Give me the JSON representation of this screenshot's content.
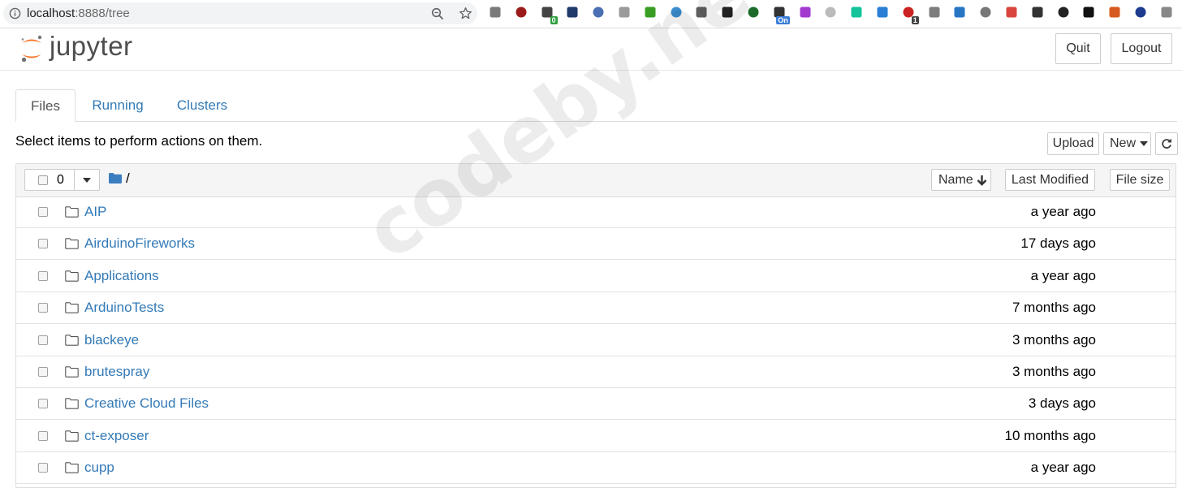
{
  "browser": {
    "url_host": "localhost",
    "url_rest": ":8888/tree",
    "extensions": [
      {
        "icon": "puzzle-icon",
        "color": "#7a7a7a",
        "badge": ""
      },
      {
        "icon": "ublock-icon",
        "color": "#9b1b1b",
        "badge": ""
      },
      {
        "icon": "scissors-icon",
        "color": "#444444",
        "badge": "0",
        "badge_color": "#2e9e3e"
      },
      {
        "icon": "y-icon",
        "color": "#1f3a6b",
        "badge": ""
      },
      {
        "icon": "globe-icon",
        "color": "#4a6fb3",
        "badge": ""
      },
      {
        "icon": "disc-icon",
        "color": "#9a9a9a",
        "badge": ""
      },
      {
        "icon": "location-pin-icon",
        "color": "#3a9d23",
        "badge": ""
      },
      {
        "icon": "screenshot-icon",
        "color": "#3b8ed0",
        "badge": ""
      },
      {
        "icon": "download-icon",
        "color": "#5f5f5f",
        "badge": ""
      },
      {
        "icon": "terminal-icon",
        "color": "#222222",
        "badge": ""
      },
      {
        "icon": "bw-icon",
        "color": "#1d6b2a",
        "badge": ""
      },
      {
        "icon": "window-icon",
        "color": "#333333",
        "badge": "On",
        "badge_color": "#3b7dd8"
      },
      {
        "icon": "purple-circle-icon",
        "color": "#a23ad0",
        "badge": ""
      },
      {
        "icon": "ink-icon",
        "color": "#bbbbbb",
        "badge": ""
      },
      {
        "icon": "grammarly-icon",
        "color": "#15c39a",
        "badge": ""
      },
      {
        "icon": "wave-icon",
        "color": "#2a7fd4",
        "badge": ""
      },
      {
        "icon": "red-square-icon",
        "color": "#cc2222",
        "badge": "1",
        "badge_color": "#444444"
      },
      {
        "icon": "drive-icon",
        "color": "#7d7d7d",
        "badge": ""
      },
      {
        "icon": "eye-icon",
        "color": "#2676c4",
        "badge": ""
      },
      {
        "icon": "tag-icon",
        "color": "#777777",
        "badge": ""
      },
      {
        "icon": "checker-icon",
        "color": "#d9453d",
        "badge": ""
      },
      {
        "icon": "graduation-cap-icon",
        "color": "#333333",
        "badge": ""
      },
      {
        "icon": "arrow-icon",
        "color": "#222222",
        "badge": ""
      },
      {
        "icon": "speaker-icon",
        "color": "#111111",
        "badge": ""
      },
      {
        "icon": "line-icon",
        "color": "#d65a1f",
        "badge": ""
      },
      {
        "icon": "n-icon",
        "color": "#1d3b8f",
        "badge": ""
      },
      {
        "icon": "camera-icon",
        "color": "#888888",
        "badge": ""
      }
    ]
  },
  "header": {
    "logo_text": "jupyter",
    "quit_label": "Quit",
    "logout_label": "Logout"
  },
  "tabs": [
    {
      "label": "Files",
      "active": true
    },
    {
      "label": "Running",
      "active": false
    },
    {
      "label": "Clusters",
      "active": false
    }
  ],
  "instructions": "Select items to perform actions on them.",
  "actions": {
    "upload_label": "Upload",
    "new_label": "New"
  },
  "list_header": {
    "selected_count": "0",
    "path": "/",
    "name_label": "Name",
    "last_modified_label": "Last Modified",
    "file_size_label": "File size"
  },
  "files": [
    {
      "name": "AIP",
      "modified": "a year ago"
    },
    {
      "name": "AirduinoFireworks",
      "modified": "17 days ago"
    },
    {
      "name": "Applications",
      "modified": "a year ago"
    },
    {
      "name": "ArduinoTests",
      "modified": "7 months ago"
    },
    {
      "name": "blackeye",
      "modified": "3 months ago"
    },
    {
      "name": "brutespray",
      "modified": "3 months ago"
    },
    {
      "name": "Creative Cloud Files",
      "modified": "3 days ago"
    },
    {
      "name": "ct-exposer",
      "modified": "10 months ago"
    },
    {
      "name": "cupp",
      "modified": "a year ago"
    }
  ],
  "watermark": "codeby.net",
  "colors": {
    "link": "#337ab7",
    "jupyter_orange": "#f37726",
    "folder_blue": "#3a7ebf"
  }
}
